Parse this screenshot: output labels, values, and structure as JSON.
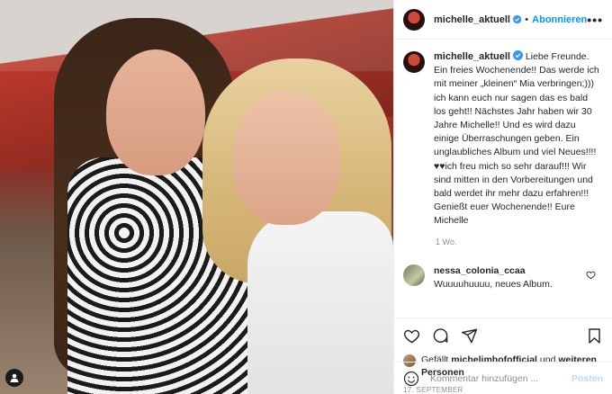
{
  "post": {
    "username": "michelle_aktuell",
    "follow_label": "Abonnieren",
    "more_label": "•••",
    "caption": "Liebe Freunde. Ein freies Wochenende!! Das werde ich mit meiner „kleinen“ Mia verbringen;))) ich kann euch nur sagen das es bald los geht!! Nächstes Jahr haben wir 30 Jahre Michelle!! Und es wird dazu einige Überraschungen geben. Ein unglaubliches Album und viel Neues!!!!♥♥ich freu mich so sehr darauf!!! Wir sind mitten in den Vorbereitungen und bald werdet ihr mehr dazu erfahren!!! Genießt euer Wochenende!! Eure Michelle",
    "time_ago": "1 Wo.",
    "comment": {
      "username": "nessa_colonia_ccaa",
      "text": "Wuuuuhuuuu, neues Album."
    },
    "likes": {
      "prefix": "Gefällt",
      "liker": "michelimhofofficial",
      "conj": "und",
      "others": "weiteren Personen"
    },
    "date": "17. SEPTEMBER",
    "comment_input": {
      "placeholder": "Kommentar hinzufügen ...",
      "post_label": "Posten"
    }
  },
  "icons": [
    "user-tag-icon",
    "verified-icon",
    "heart-icon",
    "comment-icon",
    "share-icon",
    "save-icon",
    "emoji-icon",
    "heart-small-icon"
  ],
  "colors": {
    "link_blue": "#0095f6",
    "post_disabled": "#b3dbff",
    "secondary": "#8e8e8e"
  }
}
